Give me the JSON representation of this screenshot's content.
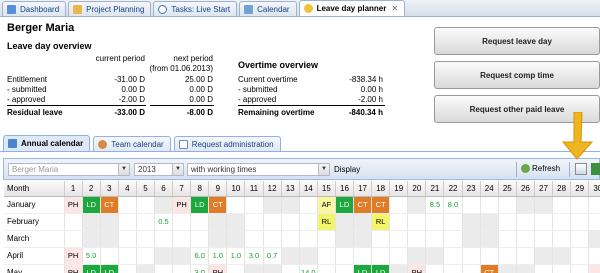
{
  "tabs": [
    {
      "label": "Dashboard",
      "icon": "dashboard-icon",
      "color": "#5b8ed6"
    },
    {
      "label": "Project Planning",
      "icon": "folder-icon",
      "color": "#e8b64a"
    },
    {
      "label": "Tasks: Live Start",
      "icon": "play-icon",
      "color": "#3b6fc1"
    },
    {
      "label": "Calendar",
      "icon": "calendar-icon",
      "color": "#6fa4d8"
    },
    {
      "label": "Leave day planner",
      "icon": "leave-icon",
      "color": "#f0c23c"
    }
  ],
  "header": {
    "name": "Berger Maria",
    "overview_title": "Leave day overview",
    "overtime_title": "Overtime overview"
  },
  "leave": {
    "col_current": "current period",
    "col_next_1": "next period",
    "col_next_2": "(from 01.06.2013)",
    "rows": [
      {
        "label": "Entitlement",
        "current": "-31.00 D",
        "next": "25.00 D"
      },
      {
        "label": "- submitted",
        "current": "0.00 D",
        "next": "0.00 D"
      },
      {
        "label": "- approved",
        "current": "-2.00 D",
        "next": "0.00 D"
      }
    ],
    "residual_label": "Residual leave",
    "residual_current": "-33.00 D",
    "residual_next": "-8.00 D"
  },
  "overtime": {
    "rows": [
      {
        "label": "Current overtime",
        "value": "-838.34 h"
      },
      {
        "label": "- submitted",
        "value": "0.00 h"
      },
      {
        "label": "- approved",
        "value": "-2.00 h"
      }
    ],
    "remaining_label": "Remaining overtime",
    "remaining_value": "-840.34 h"
  },
  "buttons": {
    "leave": "Request leave day",
    "comp": "Request comp time",
    "other": "Request other paid leave"
  },
  "subtabs": [
    {
      "label": "Annual calendar",
      "icon": "calendar-icon"
    },
    {
      "label": "Team calendar",
      "icon": "team-icon"
    },
    {
      "label": "Request administration",
      "icon": "document-icon"
    }
  ],
  "toolbar": {
    "employee": "Berger Maria",
    "year": "2013",
    "mode": "with working times",
    "display": "Display",
    "refresh": "Refresh"
  },
  "grid": {
    "month_header": "Month",
    "days": [
      "1",
      "2",
      "3",
      "4",
      "5",
      "6",
      "7",
      "8",
      "9",
      "10",
      "11",
      "12",
      "13",
      "14",
      "15",
      "16",
      "17",
      "18",
      "19",
      "20",
      "21",
      "22",
      "23",
      "24",
      "25",
      "26",
      "27",
      "28",
      "29",
      "30"
    ],
    "rows": [
      {
        "month": "January",
        "cells": [
          [
            "PH",
            "PH"
          ],
          [
            "LD",
            "LD"
          ],
          [
            "CT",
            "CT"
          ],
          [
            "",
            ""
          ],
          [
            "",
            ""
          ],
          [
            "we",
            ""
          ],
          [
            "PH",
            "PH"
          ],
          [
            "LD",
            "LD"
          ],
          [
            "CT",
            "CT"
          ],
          [
            "",
            ""
          ],
          [
            "",
            ""
          ],
          [
            "we",
            ""
          ],
          [
            "we",
            ""
          ],
          [
            "",
            ""
          ],
          [
            "AF",
            "AF"
          ],
          [
            "LD",
            "LD"
          ],
          [
            "CT",
            "CT"
          ],
          [
            "CT",
            "CT"
          ],
          [
            "",
            ""
          ],
          [
            "we",
            ""
          ],
          [
            "green",
            "8.5"
          ],
          [
            "green",
            "8.0"
          ],
          [
            "",
            ""
          ],
          [
            "",
            ""
          ],
          [
            "",
            ""
          ],
          [
            "we",
            ""
          ],
          [
            "we",
            ""
          ],
          [
            "",
            ""
          ],
          [
            "",
            ""
          ],
          [
            "",
            ""
          ]
        ]
      },
      {
        "month": "February",
        "cells": [
          [
            "",
            ""
          ],
          [
            "we",
            ""
          ],
          [
            "we",
            ""
          ],
          [
            "",
            ""
          ],
          [
            "",
            ""
          ],
          [
            "green",
            "0.5"
          ],
          [
            "",
            ""
          ],
          [
            "",
            ""
          ],
          [
            "we",
            ""
          ],
          [
            "we",
            ""
          ],
          [
            "",
            ""
          ],
          [
            "",
            ""
          ],
          [
            "",
            ""
          ],
          [
            "",
            ""
          ],
          [
            "RL",
            "RL"
          ],
          [
            "we",
            ""
          ],
          [
            "we",
            ""
          ],
          [
            "RL",
            "RL"
          ],
          [
            "",
            ""
          ],
          [
            "",
            ""
          ],
          [
            "",
            ""
          ],
          [
            "",
            ""
          ],
          [
            "we",
            ""
          ],
          [
            "we",
            ""
          ],
          [
            "",
            ""
          ],
          [
            "",
            ""
          ],
          [
            "",
            ""
          ],
          [
            "",
            ""
          ],
          [
            "",
            ""
          ],
          [
            "",
            ""
          ]
        ]
      },
      {
        "month": "March",
        "cells": [
          [
            "",
            ""
          ],
          [
            "we",
            ""
          ],
          [
            "we",
            ""
          ],
          [
            "",
            ""
          ],
          [
            "",
            ""
          ],
          [
            "",
            ""
          ],
          [
            "",
            ""
          ],
          [
            "",
            ""
          ],
          [
            "we",
            ""
          ],
          [
            "we",
            ""
          ],
          [
            "",
            ""
          ],
          [
            "",
            ""
          ],
          [
            "",
            ""
          ],
          [
            "",
            ""
          ],
          [
            "",
            ""
          ],
          [
            "we",
            ""
          ],
          [
            "we",
            ""
          ],
          [
            "",
            ""
          ],
          [
            "",
            ""
          ],
          [
            "",
            ""
          ],
          [
            "",
            ""
          ],
          [
            "",
            ""
          ],
          [
            "we",
            ""
          ],
          [
            "we",
            ""
          ],
          [
            "",
            ""
          ],
          [
            "",
            ""
          ],
          [
            "",
            ""
          ],
          [
            "",
            ""
          ],
          [
            "",
            ""
          ],
          [
            "we",
            ""
          ]
        ]
      },
      {
        "month": "April",
        "cells": [
          [
            "PH",
            "PH"
          ],
          [
            "green",
            "5.0"
          ],
          [
            "",
            ""
          ],
          [
            "",
            ""
          ],
          [
            "",
            ""
          ],
          [
            "we",
            ""
          ],
          [
            "we",
            ""
          ],
          [
            "green",
            "6.0"
          ],
          [
            "green",
            "1.0"
          ],
          [
            "green",
            "1.0"
          ],
          [
            "green",
            "3.0"
          ],
          [
            "green",
            "0.7"
          ],
          [
            "we",
            ""
          ],
          [
            "we",
            ""
          ],
          [
            "",
            ""
          ],
          [
            "",
            ""
          ],
          [
            "",
            ""
          ],
          [
            "",
            ""
          ],
          [
            "",
            ""
          ],
          [
            "we",
            ""
          ],
          [
            "we",
            ""
          ],
          [
            "",
            ""
          ],
          [
            "",
            ""
          ],
          [
            "",
            ""
          ],
          [
            "",
            ""
          ],
          [
            "",
            ""
          ],
          [
            "we",
            ""
          ],
          [
            "we",
            ""
          ],
          [
            "",
            ""
          ],
          [
            "",
            ""
          ]
        ]
      },
      {
        "month": "May",
        "cells": [
          [
            "PH",
            "PH"
          ],
          [
            "LD",
            "LD"
          ],
          [
            "LD",
            "LD"
          ],
          [
            "",
            ""
          ],
          [
            "we",
            ""
          ],
          [
            "",
            ""
          ],
          [
            "",
            ""
          ],
          [
            "green",
            "3.0"
          ],
          [
            "PH",
            "PH"
          ],
          [
            "",
            ""
          ],
          [
            "we",
            ""
          ],
          [
            "we",
            ""
          ],
          [
            "",
            ""
          ],
          [
            "green",
            "14.0"
          ],
          [
            "",
            ""
          ],
          [
            "",
            ""
          ],
          [
            "LD",
            "LD"
          ],
          [
            "LD",
            "LD"
          ],
          [
            "we",
            ""
          ],
          [
            "PH",
            "PH"
          ],
          [
            "",
            ""
          ],
          [
            "",
            ""
          ],
          [
            "",
            ""
          ],
          [
            "CT",
            "CT"
          ],
          [
            "we",
            ""
          ],
          [
            "we",
            ""
          ],
          [
            "",
            ""
          ],
          [
            "",
            ""
          ],
          [
            "",
            ""
          ],
          [
            "PH",
            ""
          ]
        ]
      }
    ]
  }
}
